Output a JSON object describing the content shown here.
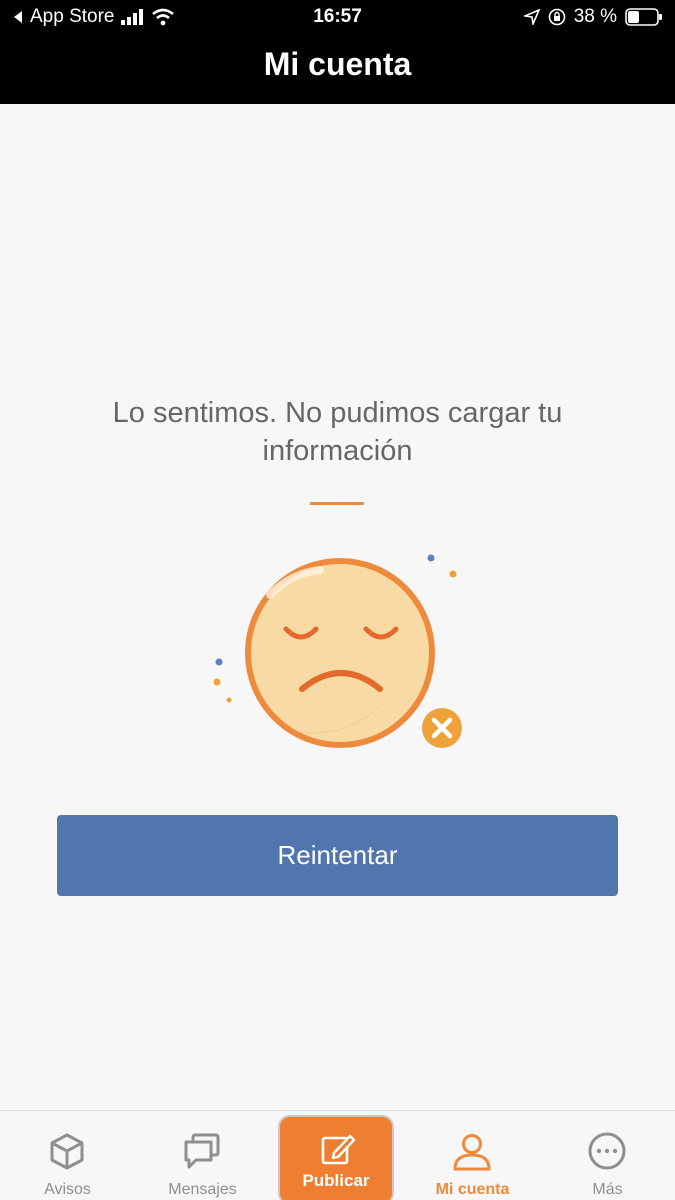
{
  "status_bar": {
    "back_app": "App Store",
    "time": "16:57",
    "battery": "38 %"
  },
  "header": {
    "title": "Mi cuenta"
  },
  "error": {
    "line1": "Lo sentimos. No pudimos cargar tu",
    "line2": "información",
    "retry_label": "Reintentar"
  },
  "tabs": [
    {
      "label": "Avisos",
      "icon": "cube-icon",
      "active": false
    },
    {
      "label": "Mensajes",
      "icon": "chat-icon",
      "active": false
    },
    {
      "label": "Publicar",
      "icon": "edit-icon",
      "active": false
    },
    {
      "label": "Mi cuenta",
      "icon": "user-icon",
      "active": true
    },
    {
      "label": "Más",
      "icon": "more-icon",
      "active": false
    }
  ],
  "colors": {
    "accent": "#ee8a3c",
    "button": "#5176ad",
    "header_bg": "#000000"
  }
}
